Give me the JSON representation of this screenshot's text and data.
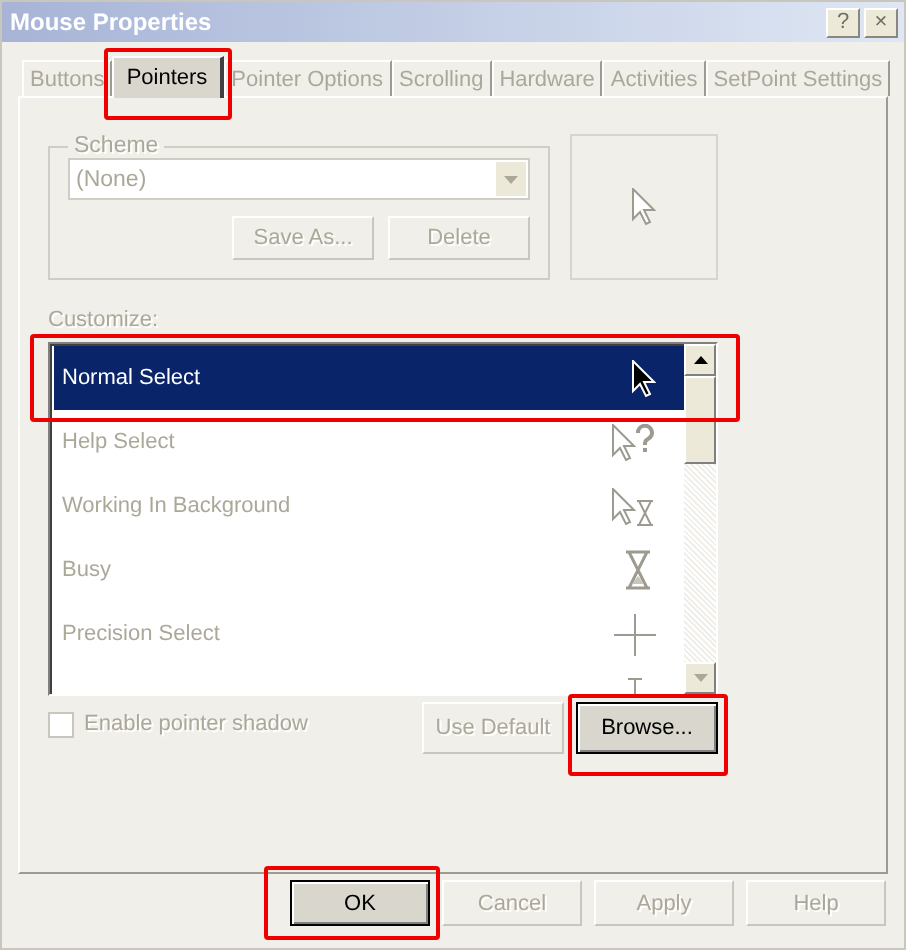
{
  "window": {
    "title": "Mouse Properties",
    "title_buttons": [
      "?",
      "×"
    ]
  },
  "tabs": [
    {
      "label": "Buttons",
      "selected": false,
      "highlighted": false
    },
    {
      "label": "Pointers",
      "selected": true,
      "highlighted": true
    },
    {
      "label": "Pointer Options",
      "selected": false,
      "highlighted": false
    },
    {
      "label": "Scrolling",
      "selected": false,
      "highlighted": false
    },
    {
      "label": "Hardware",
      "selected": false,
      "highlighted": false
    },
    {
      "label": "Activities",
      "selected": false,
      "highlighted": false
    },
    {
      "label": "SetPoint Settings",
      "selected": false,
      "highlighted": false
    }
  ],
  "scheme": {
    "legend": "Scheme",
    "value": "(None)",
    "disabled": true,
    "buttons": [
      {
        "label": "Save As...",
        "disabled": true
      },
      {
        "label": "Delete",
        "disabled": true
      }
    ]
  },
  "customize": {
    "label": "Customize:",
    "items": [
      {
        "label": "Normal Select",
        "kind": "arrow",
        "selected": true,
        "highlighted": true
      },
      {
        "label": "Help Select",
        "kind": "help",
        "selected": false,
        "highlighted": false
      },
      {
        "label": "Working In Background",
        "kind": "working",
        "selected": false,
        "highlighted": false
      },
      {
        "label": "Busy",
        "kind": "busy",
        "selected": false,
        "highlighted": false
      },
      {
        "label": "Precision Select",
        "kind": "cross",
        "selected": false,
        "highlighted": false
      },
      {
        "kind": "text",
        "selected": false,
        "highlighted": false
      }
    ]
  },
  "shadow": {
    "label": "Enable pointer shadow",
    "checked": false,
    "disabled": true
  },
  "list_buttons": [
    {
      "label": "Use Default",
      "disabled": true,
      "highlighted": false
    },
    {
      "label": "Browse...",
      "disabled": false,
      "highlighted": true
    }
  ],
  "dialog_buttons": [
    {
      "label": "OK",
      "disabled": false,
      "highlighted": true
    },
    {
      "label": "Cancel",
      "disabled": true,
      "highlighted": false
    },
    {
      "label": "Apply",
      "disabled": true,
      "highlighted": false
    },
    {
      "label": "Help",
      "disabled": true,
      "highlighted": false
    }
  ]
}
